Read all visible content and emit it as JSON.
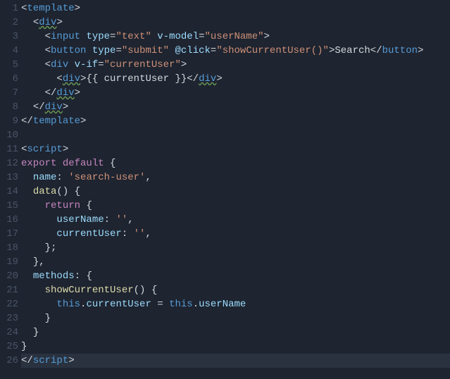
{
  "gutter": [
    "1",
    "2",
    "3",
    "4",
    "5",
    "6",
    "7",
    "8",
    "9",
    "10",
    "11",
    "12",
    "13",
    "14",
    "15",
    "16",
    "17",
    "18",
    "19",
    "20",
    "21",
    "22",
    "23",
    "24",
    "25",
    "26"
  ],
  "highlightLine": 26,
  "code": {
    "l1": [
      [
        "c-punc",
        "<"
      ],
      [
        "c-tag",
        "template"
      ],
      [
        "c-punc",
        ">"
      ]
    ],
    "l2": [
      [
        "c-plain",
        "  "
      ],
      [
        "c-punc",
        "<"
      ],
      [
        "c-tagw",
        "div"
      ],
      [
        "c-punc",
        ">"
      ]
    ],
    "l3": [
      [
        "c-plain",
        "    "
      ],
      [
        "c-punc",
        "<"
      ],
      [
        "c-tag",
        "input"
      ],
      [
        "c-plain",
        " "
      ],
      [
        "c-attr",
        "type"
      ],
      [
        "c-punc",
        "="
      ],
      [
        "c-str",
        "\"text\""
      ],
      [
        "c-plain",
        " "
      ],
      [
        "c-attr",
        "v-model"
      ],
      [
        "c-punc",
        "="
      ],
      [
        "c-str",
        "\"userName\""
      ],
      [
        "c-punc",
        ">"
      ]
    ],
    "l4": [
      [
        "c-plain",
        "    "
      ],
      [
        "c-punc",
        "<"
      ],
      [
        "c-tag",
        "button"
      ],
      [
        "c-plain",
        " "
      ],
      [
        "c-attr",
        "type"
      ],
      [
        "c-punc",
        "="
      ],
      [
        "c-str",
        "\"submit\""
      ],
      [
        "c-plain",
        " "
      ],
      [
        "c-attr",
        "@click"
      ],
      [
        "c-punc",
        "="
      ],
      [
        "c-str",
        "\"showCurrentUser()\""
      ],
      [
        "c-punc",
        ">"
      ],
      [
        "c-plain",
        "Search"
      ],
      [
        "c-punc",
        "</"
      ],
      [
        "c-tag",
        "button"
      ],
      [
        "c-punc",
        ">"
      ]
    ],
    "l5": [
      [
        "c-plain",
        "    "
      ],
      [
        "c-punc",
        "<"
      ],
      [
        "c-tag",
        "div"
      ],
      [
        "c-plain",
        " "
      ],
      [
        "c-attr",
        "v-if"
      ],
      [
        "c-punc",
        "="
      ],
      [
        "c-str",
        "\"currentUser\""
      ],
      [
        "c-punc",
        ">"
      ]
    ],
    "l6": [
      [
        "c-plain",
        "      "
      ],
      [
        "c-punc",
        "<"
      ],
      [
        "c-tagw",
        "div"
      ],
      [
        "c-punc",
        ">"
      ],
      [
        "c-plain",
        "{{ currentUser }}"
      ],
      [
        "c-punc",
        "</"
      ],
      [
        "c-tagw",
        "div"
      ],
      [
        "c-punc",
        ">"
      ]
    ],
    "l7": [
      [
        "c-plain",
        "    "
      ],
      [
        "c-punc",
        "</"
      ],
      [
        "c-tagw",
        "div"
      ],
      [
        "c-punc",
        ">"
      ]
    ],
    "l8": [
      [
        "c-plain",
        "  "
      ],
      [
        "c-punc",
        "</"
      ],
      [
        "c-tagw",
        "div"
      ],
      [
        "c-punc",
        ">"
      ]
    ],
    "l9": [
      [
        "c-punc",
        "</"
      ],
      [
        "c-tag",
        "template"
      ],
      [
        "c-punc",
        ">"
      ]
    ],
    "l10": [],
    "l11": [
      [
        "c-punc",
        "<"
      ],
      [
        "c-tag",
        "script"
      ],
      [
        "c-punc",
        ">"
      ]
    ],
    "l12": [
      [
        "c-kw",
        "export"
      ],
      [
        "c-plain",
        " "
      ],
      [
        "c-kw",
        "default"
      ],
      [
        "c-plain",
        " "
      ],
      [
        "c-punc",
        "{"
      ]
    ],
    "l13": [
      [
        "c-plain",
        "  "
      ],
      [
        "c-prop",
        "name"
      ],
      [
        "c-punc",
        ":"
      ],
      [
        "c-plain",
        " "
      ],
      [
        "c-str",
        "'search-user'"
      ],
      [
        "c-punc",
        ","
      ]
    ],
    "l14": [
      [
        "c-plain",
        "  "
      ],
      [
        "c-fn",
        "data"
      ],
      [
        "c-punc",
        "()"
      ],
      [
        "c-plain",
        " "
      ],
      [
        "c-punc",
        "{"
      ]
    ],
    "l15": [
      [
        "c-plain",
        "    "
      ],
      [
        "c-kw",
        "return"
      ],
      [
        "c-plain",
        " "
      ],
      [
        "c-punc",
        "{"
      ]
    ],
    "l16": [
      [
        "c-plain",
        "      "
      ],
      [
        "c-prop",
        "userName"
      ],
      [
        "c-punc",
        ":"
      ],
      [
        "c-plain",
        " "
      ],
      [
        "c-str",
        "''"
      ],
      [
        "c-punc",
        ","
      ]
    ],
    "l17": [
      [
        "c-plain",
        "      "
      ],
      [
        "c-prop",
        "currentUser"
      ],
      [
        "c-punc",
        ":"
      ],
      [
        "c-plain",
        " "
      ],
      [
        "c-str",
        "''"
      ],
      [
        "c-punc",
        ","
      ]
    ],
    "l18": [
      [
        "c-plain",
        "    "
      ],
      [
        "c-punc",
        "};"
      ]
    ],
    "l19": [
      [
        "c-plain",
        "  "
      ],
      [
        "c-punc",
        "},"
      ]
    ],
    "l20": [
      [
        "c-plain",
        "  "
      ],
      [
        "c-prop",
        "methods"
      ],
      [
        "c-punc",
        ":"
      ],
      [
        "c-plain",
        " "
      ],
      [
        "c-punc",
        "{"
      ]
    ],
    "l21": [
      [
        "c-plain",
        "    "
      ],
      [
        "c-fn",
        "showCurrentUser"
      ],
      [
        "c-punc",
        "()"
      ],
      [
        "c-plain",
        " "
      ],
      [
        "c-punc",
        "{"
      ]
    ],
    "l22": [
      [
        "c-plain",
        "      "
      ],
      [
        "c-this",
        "this"
      ],
      [
        "c-punc",
        "."
      ],
      [
        "c-var",
        "currentUser"
      ],
      [
        "c-plain",
        " "
      ],
      [
        "c-punc",
        "="
      ],
      [
        "c-plain",
        " "
      ],
      [
        "c-this",
        "this"
      ],
      [
        "c-punc",
        "."
      ],
      [
        "c-var",
        "userName"
      ]
    ],
    "l23": [
      [
        "c-plain",
        "    "
      ],
      [
        "c-punc",
        "}"
      ]
    ],
    "l24": [
      [
        "c-plain",
        "  "
      ],
      [
        "c-punc",
        "}"
      ]
    ],
    "l25": [
      [
        "c-punc",
        "}"
      ]
    ],
    "l26": [
      [
        "c-punc",
        "</"
      ],
      [
        "c-tag",
        "script"
      ],
      [
        "c-punc",
        ">"
      ]
    ]
  }
}
